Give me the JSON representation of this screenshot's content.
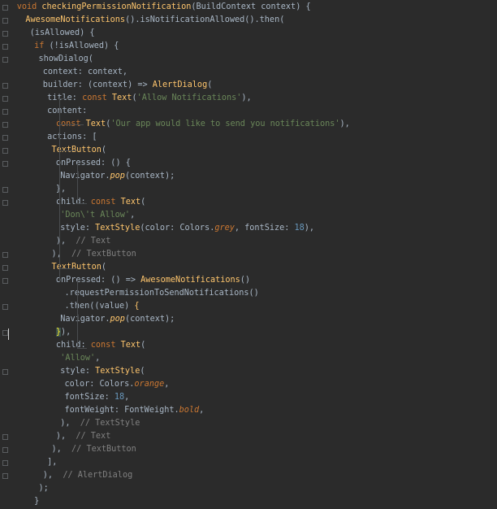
{
  "code_lines": [
    {
      "indent": 2,
      "tokens": [
        {
          "t": "void ",
          "c": "kw"
        },
        {
          "t": "checkingPermissionNotification",
          "c": "fn"
        },
        {
          "t": "(",
          "c": "pm"
        },
        {
          "t": "BuildContext",
          "c": "pm"
        },
        {
          "t": " context) {",
          "c": "pm"
        }
      ]
    },
    {
      "indent": 4,
      "tokens": [
        {
          "t": "AwesomeNotifications",
          "c": "cls"
        },
        {
          "t": "().isNotificationAllowed().then(",
          "c": "pm"
        }
      ]
    },
    {
      "indent": 5,
      "tokens": [
        {
          "t": "(isAllowed) {",
          "c": "pm"
        }
      ]
    },
    {
      "indent": 6,
      "tokens": [
        {
          "t": "if ",
          "c": "kw"
        },
        {
          "t": "(!isAllowed) {",
          "c": "pm"
        }
      ]
    },
    {
      "indent": 7,
      "tokens": [
        {
          "t": "showDialog(",
          "c": "pm"
        }
      ]
    },
    {
      "indent": 8,
      "tokens": [
        {
          "t": "context: context,",
          "c": "pm"
        }
      ]
    },
    {
      "indent": 8,
      "tokens": [
        {
          "t": "builder: (context) => ",
          "c": "pm"
        },
        {
          "t": "AlertDialog",
          "c": "cls"
        },
        {
          "t": "(",
          "c": "pm"
        }
      ]
    },
    {
      "indent": 9,
      "tokens": [
        {
          "t": "title: ",
          "c": "pm"
        },
        {
          "t": "const ",
          "c": "kw"
        },
        {
          "t": "Text",
          "c": "cls"
        },
        {
          "t": "(",
          "c": "pm"
        },
        {
          "t": "'Allow Notifications'",
          "c": "str"
        },
        {
          "t": "),",
          "c": "pm"
        }
      ]
    },
    {
      "indent": 9,
      "tokens": [
        {
          "t": "content:",
          "c": "pm"
        }
      ]
    },
    {
      "indent": 11,
      "tokens": [
        {
          "t": "const ",
          "c": "kw"
        },
        {
          "t": "Text",
          "c": "cls"
        },
        {
          "t": "(",
          "c": "pm"
        },
        {
          "t": "'Our app would like to send you notifications'",
          "c": "str"
        },
        {
          "t": "),",
          "c": "pm"
        }
      ]
    },
    {
      "indent": 9,
      "tokens": [
        {
          "t": "actions: [",
          "c": "pm"
        }
      ]
    },
    {
      "indent": 10,
      "tokens": [
        {
          "t": "TextButton",
          "c": "cls"
        },
        {
          "t": "(",
          "c": "pm"
        }
      ]
    },
    {
      "indent": 11,
      "tokens": [
        {
          "t": "onPressed: () {",
          "c": "pm"
        }
      ]
    },
    {
      "indent": 12,
      "tokens": [
        {
          "t": "Navigator.",
          "c": "pm"
        },
        {
          "t": "pop",
          "c": "fn it"
        },
        {
          "t": "(context);",
          "c": "pm"
        }
      ]
    },
    {
      "indent": 11,
      "tokens": [
        {
          "t": "},",
          "c": "pm"
        }
      ]
    },
    {
      "indent": 11,
      "tokens": [
        {
          "t": "child: ",
          "c": "pm"
        },
        {
          "t": "const ",
          "c": "kw"
        },
        {
          "t": "Text",
          "c": "cls"
        },
        {
          "t": "(",
          "c": "pm"
        }
      ]
    },
    {
      "indent": 12,
      "tokens": [
        {
          "t": "'Don\\'t Allow'",
          "c": "str"
        },
        {
          "t": ",",
          "c": "pm"
        }
      ]
    },
    {
      "indent": 12,
      "tokens": [
        {
          "t": "style: ",
          "c": "pm"
        },
        {
          "t": "TextStyle",
          "c": "cls"
        },
        {
          "t": "(color: Colors.",
          "c": "pm"
        },
        {
          "t": "grey",
          "c": "kw it"
        },
        {
          "t": ", fontSize: ",
          "c": "pm"
        },
        {
          "t": "18",
          "c": "num"
        },
        {
          "t": "),",
          "c": "pm"
        }
      ]
    },
    {
      "indent": 11,
      "tokens": [
        {
          "t": "),  ",
          "c": "pm"
        },
        {
          "t": "// Text",
          "c": "cm"
        }
      ]
    },
    {
      "indent": 10,
      "tokens": [
        {
          "t": "),  ",
          "c": "pm"
        },
        {
          "t": "// TextButton",
          "c": "cm"
        }
      ]
    },
    {
      "indent": 10,
      "tokens": [
        {
          "t": "TextButton",
          "c": "cls"
        },
        {
          "t": "(",
          "c": "pm"
        }
      ]
    },
    {
      "indent": 11,
      "tokens": [
        {
          "t": "onPressed: () => ",
          "c": "pm"
        },
        {
          "t": "AwesomeNotifications",
          "c": "cls"
        },
        {
          "t": "()",
          "c": "pm"
        }
      ]
    },
    {
      "indent": 13,
      "tokens": [
        {
          "t": ".requestPermissionToSendNotifications()",
          "c": "pm"
        }
      ]
    },
    {
      "indent": 13,
      "tokens": [
        {
          "t": ".then((value) ",
          "c": "pm"
        },
        {
          "t": "{",
          "c": "fn"
        }
      ]
    },
    {
      "indent": 12,
      "tokens": [
        {
          "t": "Navigator.",
          "c": "pm"
        },
        {
          "t": "pop",
          "c": "fn it"
        },
        {
          "t": "(context);",
          "c": "pm"
        }
      ]
    },
    {
      "indent": 11,
      "tokens": [
        {
          "t": "}",
          "c": "brace-hl"
        },
        {
          "t": "),",
          "c": "pm"
        }
      ]
    },
    {
      "indent": 11,
      "tokens": [
        {
          "t": "child: ",
          "c": "pm"
        },
        {
          "t": "const ",
          "c": "kw"
        },
        {
          "t": "Text",
          "c": "cls"
        },
        {
          "t": "(",
          "c": "pm"
        }
      ]
    },
    {
      "indent": 12,
      "tokens": [
        {
          "t": "'Allow'",
          "c": "str"
        },
        {
          "t": ",",
          "c": "pm"
        }
      ]
    },
    {
      "indent": 12,
      "tokens": [
        {
          "t": "style: ",
          "c": "pm"
        },
        {
          "t": "TextStyle",
          "c": "cls"
        },
        {
          "t": "(",
          "c": "pm"
        }
      ]
    },
    {
      "indent": 13,
      "tokens": [
        {
          "t": "color: Colors.",
          "c": "pm"
        },
        {
          "t": "orange",
          "c": "kw it"
        },
        {
          "t": ",",
          "c": "pm"
        }
      ]
    },
    {
      "indent": 13,
      "tokens": [
        {
          "t": "fontSize: ",
          "c": "pm"
        },
        {
          "t": "18",
          "c": "num"
        },
        {
          "t": ",",
          "c": "pm"
        }
      ]
    },
    {
      "indent": 13,
      "tokens": [
        {
          "t": "fontWeight: FontWeight.",
          "c": "pm"
        },
        {
          "t": "bold",
          "c": "kw it"
        },
        {
          "t": ",",
          "c": "pm"
        }
      ]
    },
    {
      "indent": 12,
      "tokens": [
        {
          "t": "),  ",
          "c": "pm"
        },
        {
          "t": "// TextStyle",
          "c": "cm"
        }
      ]
    },
    {
      "indent": 11,
      "tokens": [
        {
          "t": "),  ",
          "c": "pm"
        },
        {
          "t": "// Text",
          "c": "cm"
        }
      ]
    },
    {
      "indent": 10,
      "tokens": [
        {
          "t": "),  ",
          "c": "pm"
        },
        {
          "t": "// TextButton",
          "c": "cm"
        }
      ]
    },
    {
      "indent": 9,
      "tokens": [
        {
          "t": "],",
          "c": "pm"
        }
      ]
    },
    {
      "indent": 8,
      "tokens": [
        {
          "t": "),  ",
          "c": "pm"
        },
        {
          "t": "// AlertDialog",
          "c": "cm"
        }
      ]
    },
    {
      "indent": 7,
      "tokens": [
        {
          "t": ");",
          "c": "pm"
        }
      ]
    },
    {
      "indent": 6,
      "tokens": [
        {
          "t": "}",
          "c": "pm"
        }
      ]
    }
  ],
  "colors": {
    "background": "#2b2b2b",
    "keyword": "#cc7832",
    "function": "#ffc66d",
    "string": "#6a8759",
    "number": "#6897bb",
    "comment": "#808080",
    "text": "#a9b7c6"
  }
}
